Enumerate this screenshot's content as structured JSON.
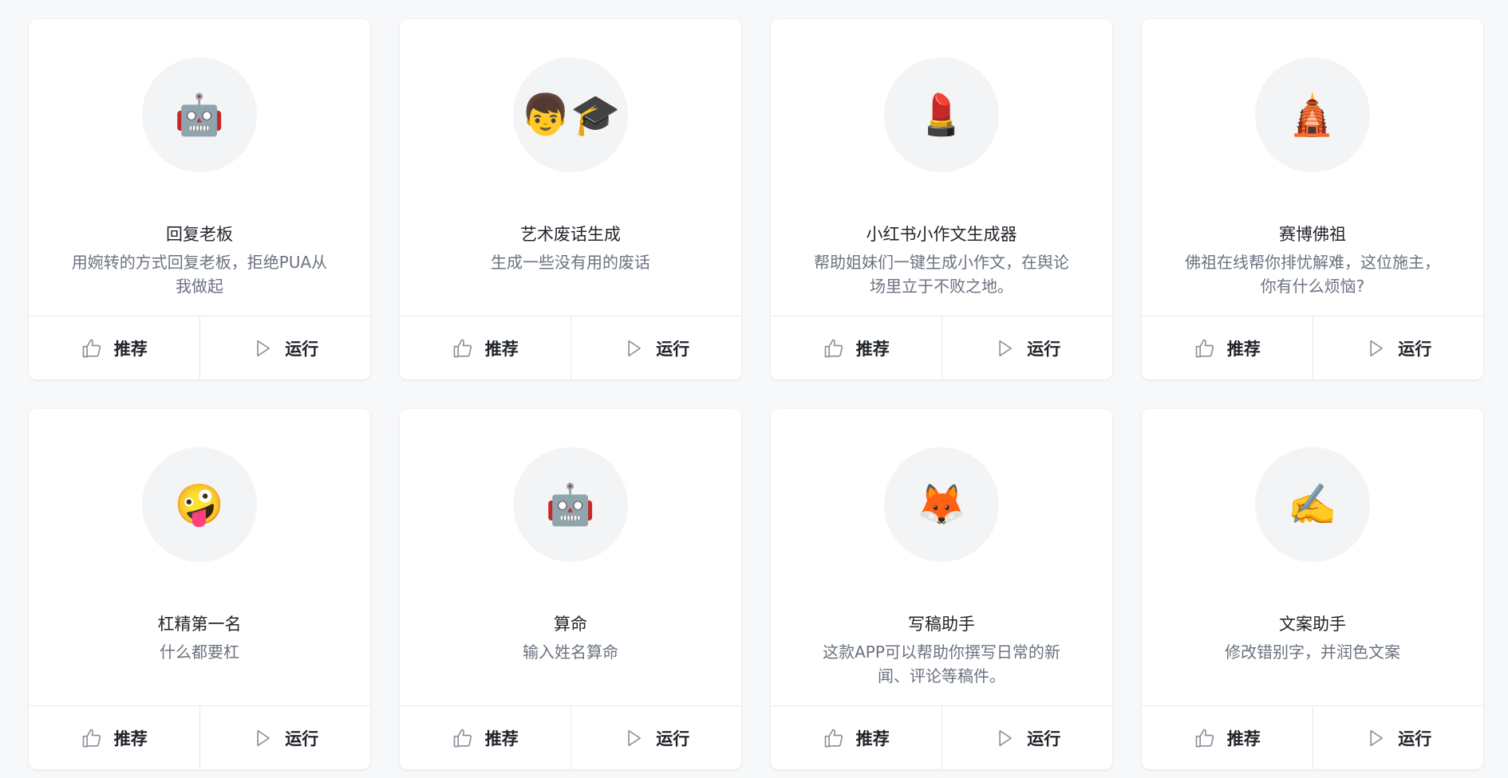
{
  "actions": {
    "recommend": "推荐",
    "run": "运行"
  },
  "cards": [
    {
      "title": "回复老板",
      "desc": "用婉转的方式回复老板，拒绝PUA从我做起",
      "icon": "🤖",
      "icon_name": "robot-icon"
    },
    {
      "title": "艺术废话生成",
      "desc": "生成一些没有用的废话",
      "icon": "👦🎓",
      "icon_name": "student-icon"
    },
    {
      "title": "小红书小作文生成器",
      "desc": "帮助姐妹们一键生成小作文，在舆论场里立于不败之地。",
      "icon": "💄",
      "icon_name": "lipstick-icon"
    },
    {
      "title": "赛博佛祖",
      "desc": "佛祖在线帮你排忧解难，这位施主，你有什么烦恼?",
      "icon": "🛕",
      "icon_name": "temple-icon"
    },
    {
      "title": "杠精第一名",
      "desc": "什么都要杠",
      "icon": "🤪",
      "icon_name": "zany-face-icon"
    },
    {
      "title": "算命",
      "desc": "输入姓名算命",
      "icon": "🤖",
      "icon_name": "robot-icon"
    },
    {
      "title": "写稿助手",
      "desc": "这款APP可以帮助你撰写日常的新闻、评论等稿件。",
      "icon": "🦊",
      "icon_name": "fox-icon"
    },
    {
      "title": "文案助手",
      "desc": "修改错别字，并润色文案",
      "icon": "✍️",
      "icon_name": "writing-hand-icon"
    }
  ]
}
